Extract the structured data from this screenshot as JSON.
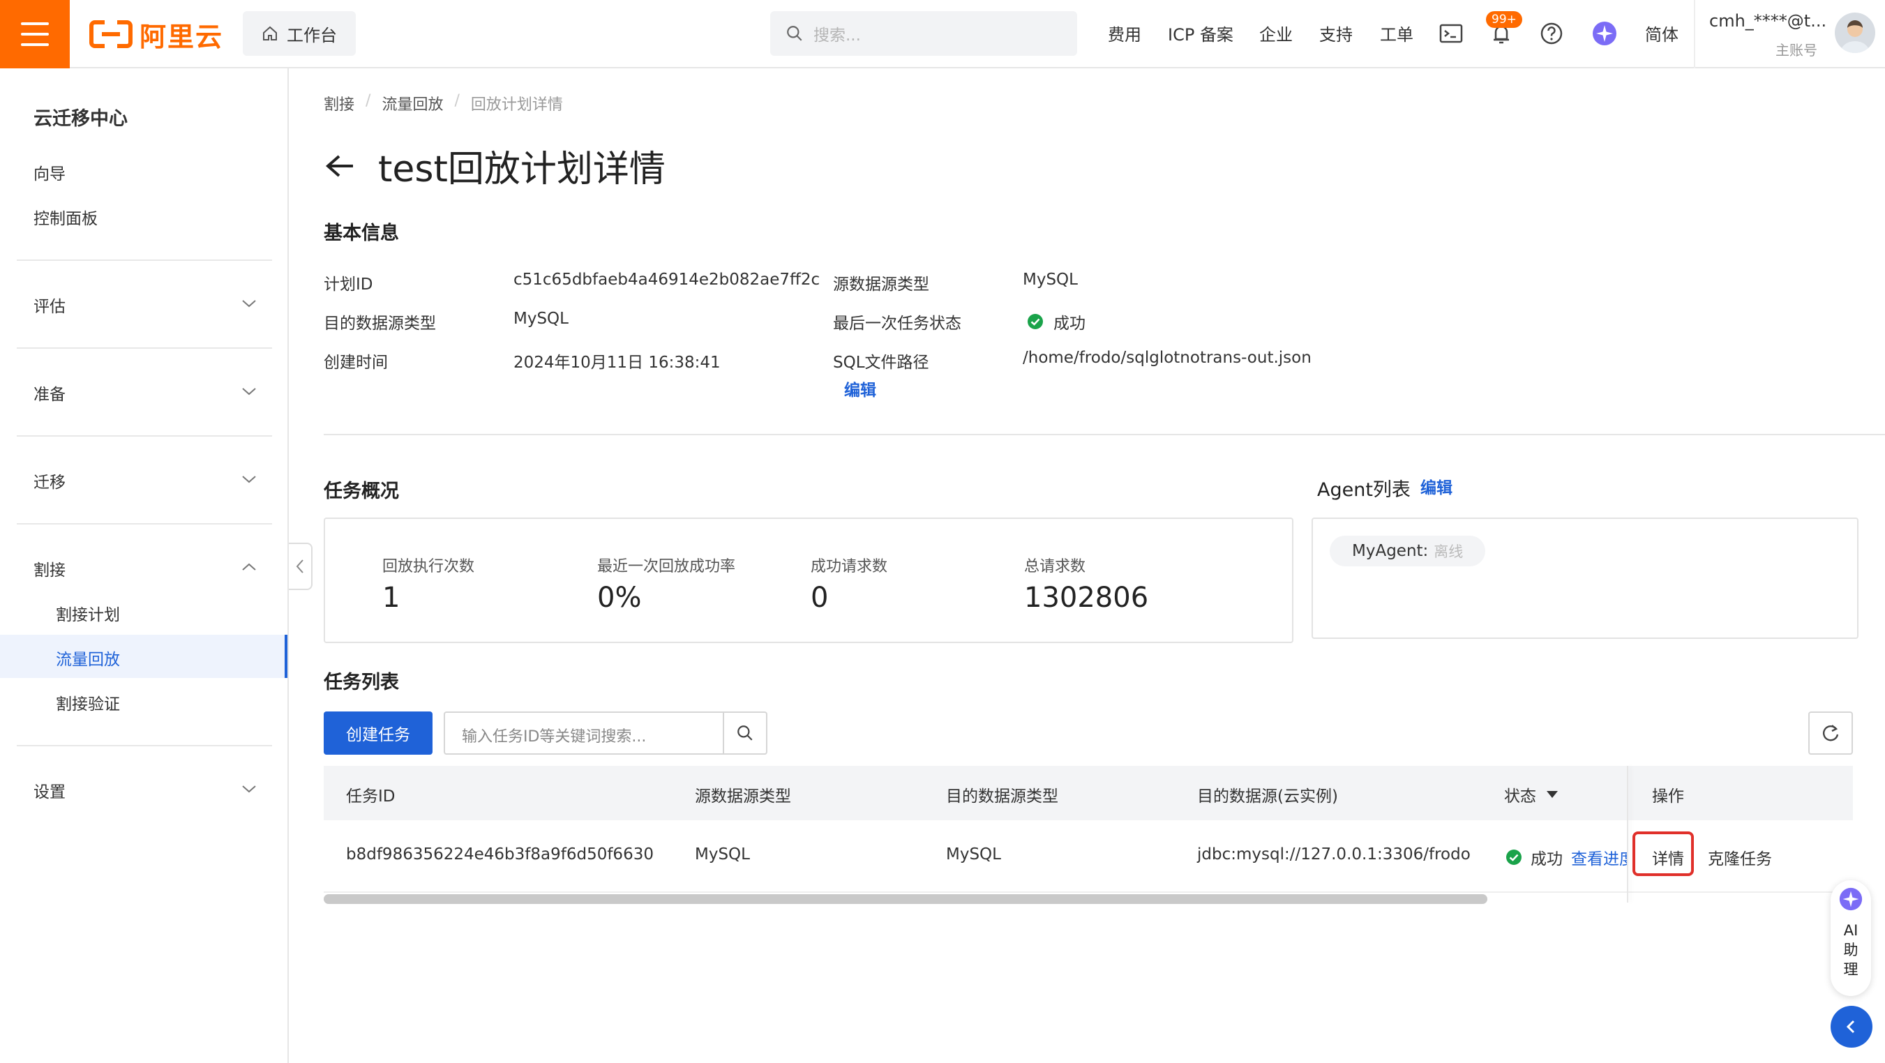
{
  "topbar": {
    "logo_text": "阿里云",
    "workbench": "工作台",
    "search_placeholder": "搜索...",
    "nav": [
      "费用",
      "ICP 备案",
      "企业",
      "支持",
      "工单"
    ],
    "notification_count": "99+",
    "language": "简体",
    "user_name": "cmh_****@t...",
    "user_role": "主账号"
  },
  "sidebar": {
    "title": "云迁移中心",
    "top_items": [
      "向导",
      "控制面板"
    ],
    "groups": {
      "assess": "评估",
      "prepare": "准备",
      "migrate": "迁移",
      "cutover": "割接",
      "settings": "设置"
    },
    "cutover_items": [
      "割接计划",
      "流量回放",
      "割接验证"
    ],
    "active_item": "流量回放"
  },
  "breadcrumb": [
    "割接",
    "流量回放",
    "回放计划详情"
  ],
  "page_title": "test回放计划详情",
  "basic_info": {
    "title": "基本信息",
    "plan_id_label": "计划ID",
    "plan_id": "c51c65dbfaeb4a46914e2b082ae7ff2c",
    "source_type_label": "源数据源类型",
    "source_type": "MySQL",
    "target_type_label": "目的数据源类型",
    "target_type": "MySQL",
    "last_status_label": "最后一次任务状态",
    "last_status": "成功",
    "created_label": "创建时间",
    "created": "2024年10月11日 16:38:41",
    "sql_path_label": "SQL文件路径",
    "sql_path": "/home/frodo/sqlglotnotrans-out.json",
    "edit": "编辑"
  },
  "overview": {
    "title": "任务概况",
    "stats": [
      {
        "label": "回放执行次数",
        "value": "1"
      },
      {
        "label": "最近一次回放成功率",
        "value": "0%"
      },
      {
        "label": "成功请求数",
        "value": "0"
      },
      {
        "label": "总请求数",
        "value": "1302806"
      }
    ]
  },
  "agents": {
    "title": "Agent列表",
    "edit": "编辑",
    "agent_name": "MyAgent:",
    "agent_status": "离线"
  },
  "tasks": {
    "title": "任务列表",
    "create_button": "创建任务",
    "search_placeholder": "输入任务ID等关键词搜索...",
    "columns": [
      "任务ID",
      "源数据源类型",
      "目的数据源类型",
      "目的数据源(云实例)",
      "状态",
      "操作"
    ],
    "rows": [
      {
        "task_id": "b8df986356224e46b3f8a9f6d50f6630",
        "source_type": "MySQL",
        "target_type": "MySQL",
        "target_instance": "jdbc:mysql://127.0.0.1:3306/frodo",
        "status": "成功",
        "view_progress": "查看进度",
        "detail": "详情",
        "clone": "克隆任务"
      }
    ]
  },
  "ai_assistant": {
    "label_lines": [
      "AI",
      "助",
      "理"
    ]
  },
  "colors": {
    "brand_orange": "#ff6a00",
    "primary_blue": "#1f62d8",
    "success_green": "#1aa34a",
    "highlight_red": "#e0302a"
  }
}
